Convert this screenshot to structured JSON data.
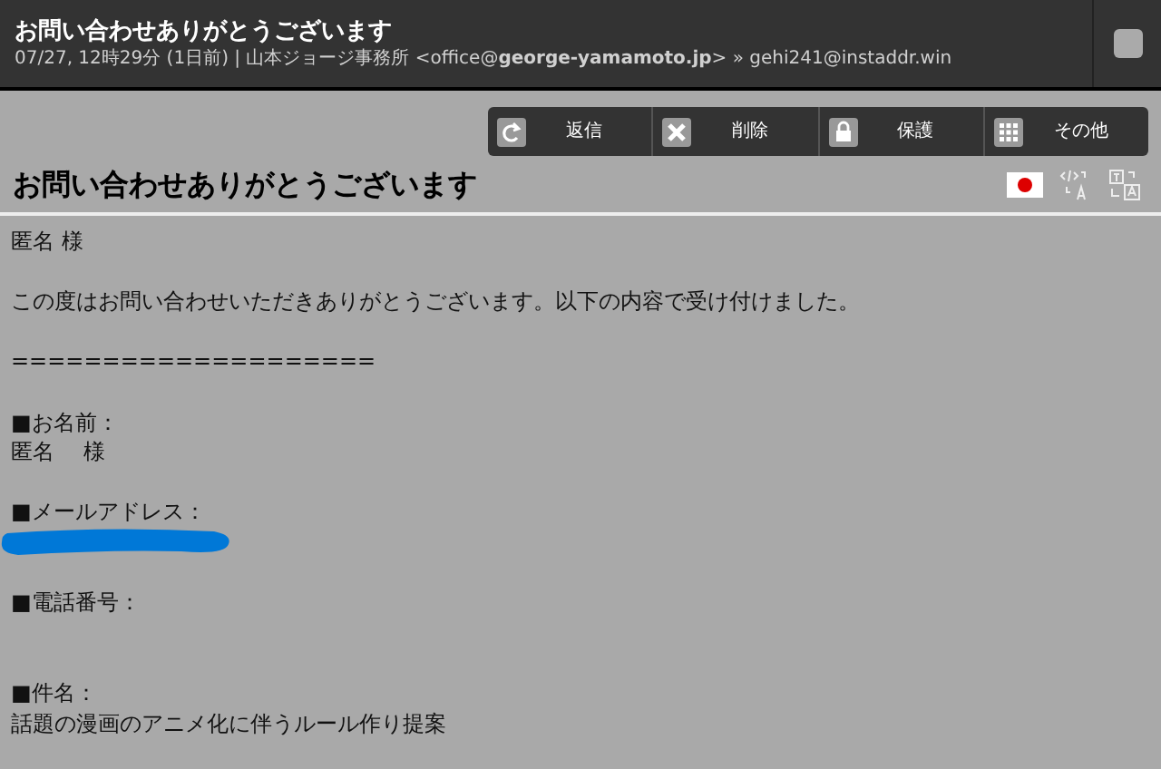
{
  "header": {
    "title": "お問い合わせありがとうございます",
    "meta": "07/27, 12時29分 (1日前) | 山本ジョージ事務所 <office@**george-yamamoto.jp**> » gehi241@instaddr.win",
    "checked": false
  },
  "toolbar": [
    {
      "kind": "reply",
      "label": "返信"
    },
    {
      "kind": "delete",
      "label": "削除"
    },
    {
      "kind": "lock",
      "label": "保護"
    },
    {
      "kind": "more",
      "label": "その他"
    }
  ],
  "subject": "お問い合わせありがとうございます",
  "body": [
    {
      "kind": "text",
      "text": "匿名 様"
    },
    {
      "kind": "blank"
    },
    {
      "kind": "text",
      "text": "この度はお問い合わせいただきありがとうございます。以下の内容で受け付けました。"
    },
    {
      "kind": "blank"
    },
    {
      "kind": "text",
      "text": "===================="
    },
    {
      "kind": "blank"
    },
    {
      "kind": "text",
      "text": "■お名前："
    },
    {
      "kind": "text",
      "text": "匿名　 様"
    },
    {
      "kind": "blank"
    },
    {
      "kind": "text",
      "text": "■メールアドレス："
    },
    {
      "kind": "redacted"
    },
    {
      "kind": "blank"
    },
    {
      "kind": "text",
      "text": "■電話番号："
    },
    {
      "kind": "blank"
    },
    {
      "kind": "blank"
    },
    {
      "kind": "text",
      "text": "■件名："
    },
    {
      "kind": "text",
      "text": "話題の漫画のアニメ化に伴うルール作り提案"
    }
  ]
}
